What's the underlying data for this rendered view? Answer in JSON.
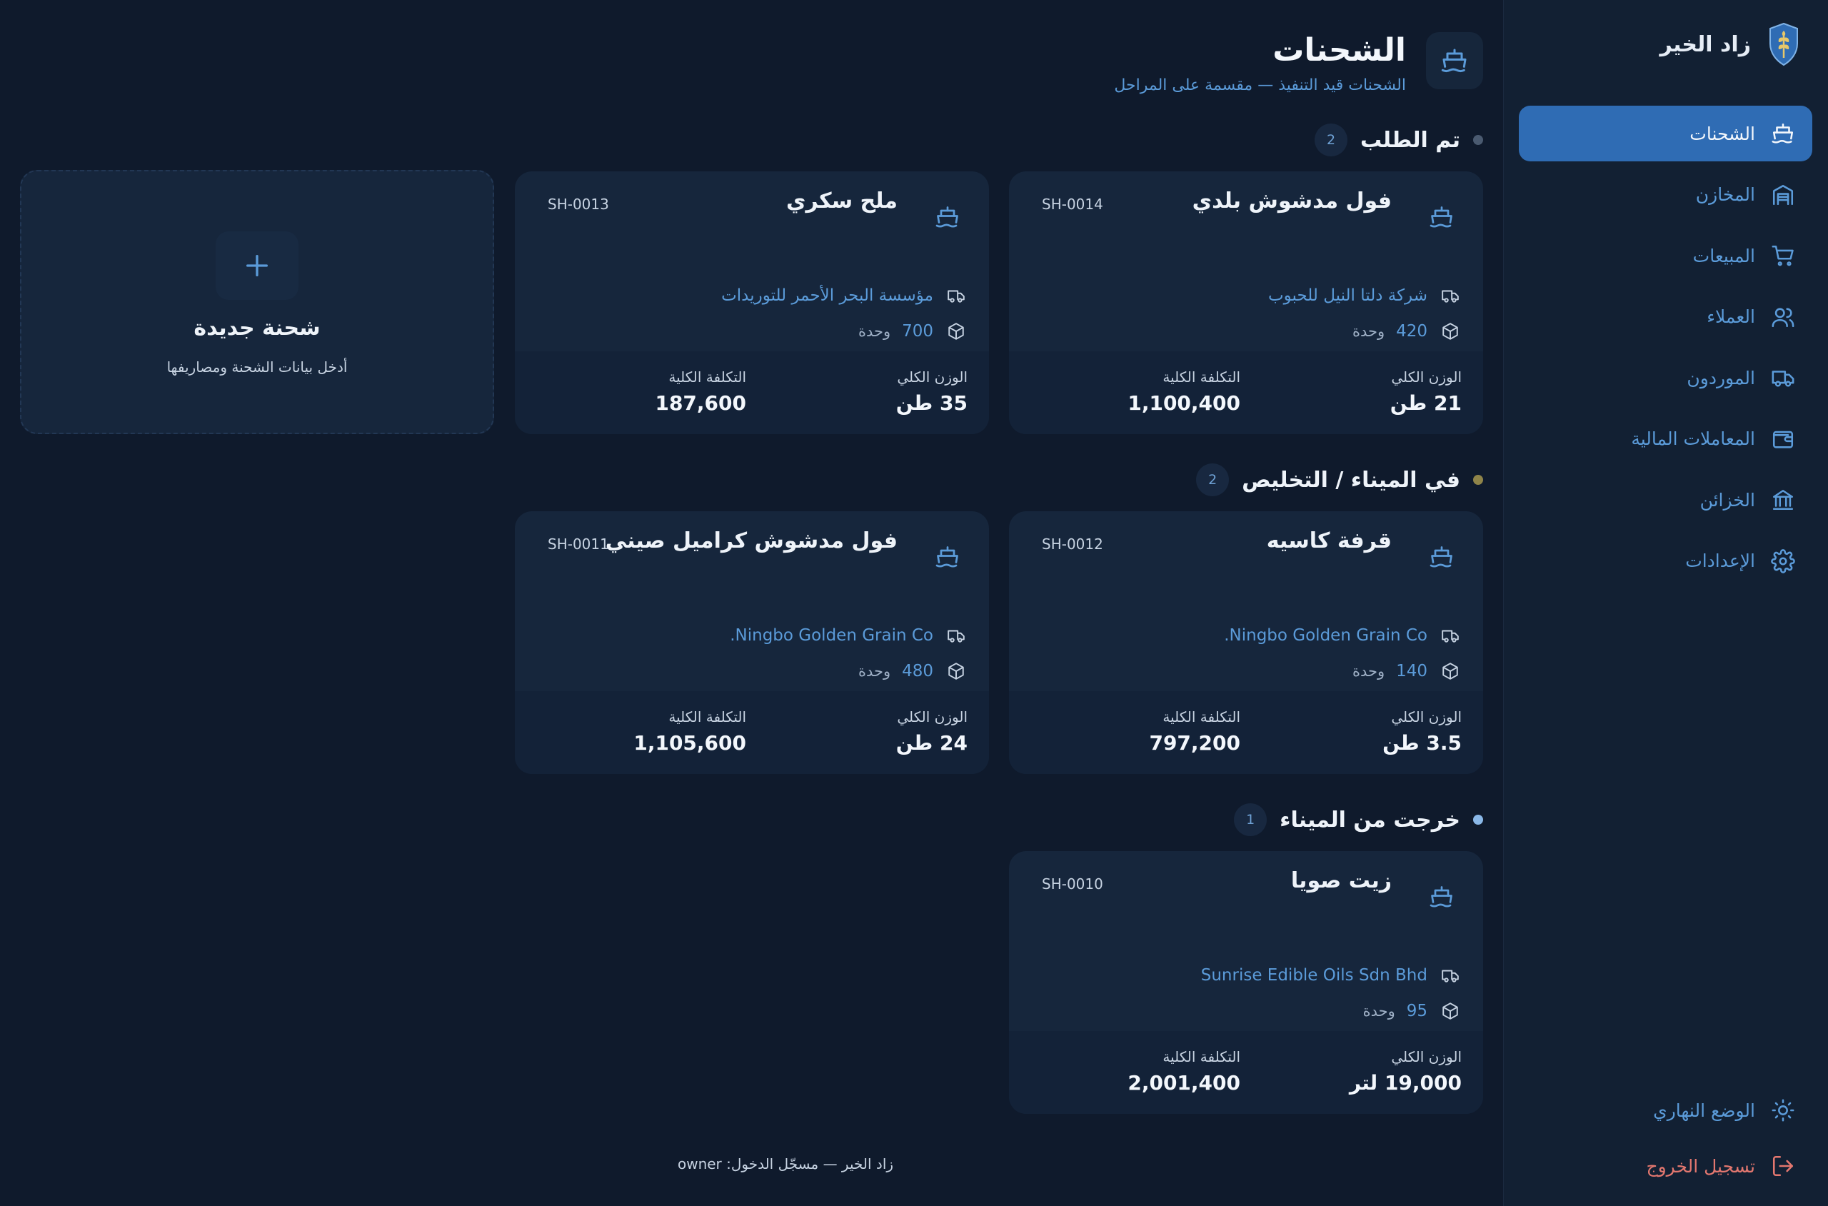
{
  "brand": {
    "name": "زاد الخير",
    "logo_icon": "wheat-shield-icon"
  },
  "sidebar": {
    "items": [
      {
        "label": "الشحنات",
        "icon": "ship-icon",
        "active": true
      },
      {
        "label": "المخازن",
        "icon": "warehouse-icon",
        "active": false
      },
      {
        "label": "المبيعات",
        "icon": "cart-icon",
        "active": false
      },
      {
        "label": "العملاء",
        "icon": "users-icon",
        "active": false
      },
      {
        "label": "الموردون",
        "icon": "truck-icon",
        "active": false
      },
      {
        "label": "المعاملات المالية",
        "icon": "wallet-icon",
        "active": false
      },
      {
        "label": "الخزائن",
        "icon": "bank-icon",
        "active": false
      },
      {
        "label": "الإعدادات",
        "icon": "gear-icon",
        "active": false
      }
    ],
    "theme_label": "الوضع النهاري",
    "logout_label": "تسجيل الخروج"
  },
  "page": {
    "title": "الشحنات",
    "subtitle": "الشحنات قيد التنفيذ — مقسمة على المراحل"
  },
  "stages": [
    {
      "title": "تم الطلب",
      "count": "2",
      "dot_color": "#4a5a70",
      "cards": [
        {
          "name": "فول مدشوش بلدي",
          "code": "SH-0014",
          "supplier": "شركة دلتا النيل للحبوب",
          "qty": "420",
          "unit": "وحدة",
          "weight_label": "الوزن الكلي",
          "weight": "21 طن",
          "cost_label": "التكلفة الكلية",
          "cost": "1,100,400"
        },
        {
          "name": "ملح سكري",
          "code": "SH-0013",
          "supplier": "مؤسسة البحر الأحمر للتوريدات",
          "qty": "700",
          "unit": "وحدة",
          "weight_label": "الوزن الكلي",
          "weight": "35 طن",
          "cost_label": "التكلفة الكلية",
          "cost": "187,600"
        }
      ]
    },
    {
      "title": "في الميناء / التخليص",
      "count": "2",
      "dot_color": "#8f8449",
      "cards": [
        {
          "name": "قرفة كاسيه",
          "code": "SH-0012",
          "supplier": "Ningbo Golden Grain Co.",
          "qty": "140",
          "unit": "وحدة",
          "weight_label": "الوزن الكلي",
          "weight": "3.5 طن",
          "cost_label": "التكلفة الكلية",
          "cost": "797,200"
        },
        {
          "name": "فول مدشوش كراميل صيني",
          "code": "SH-0011",
          "supplier": "Ningbo Golden Grain Co.",
          "qty": "480",
          "unit": "وحدة",
          "weight_label": "الوزن الكلي",
          "weight": "24 طن",
          "cost_label": "التكلفة الكلية",
          "cost": "1,105,600"
        }
      ]
    },
    {
      "title": "خرجت من الميناء",
      "count": "1",
      "dot_color": "#8ab8e8",
      "cards": [
        {
          "name": "زيت صويا",
          "code": "SH-0010",
          "supplier": "Sunrise Edible Oils Sdn Bhd",
          "qty": "95",
          "unit": "وحدة",
          "weight_label": "الوزن الكلي",
          "weight": "19,000 لتر",
          "cost_label": "التكلفة الكلية",
          "cost": "2,001,400"
        }
      ]
    }
  ],
  "new_shipment": {
    "title": "شحنة جديدة",
    "subtitle": "أدخل بيانات الشحنة ومصاريفها"
  },
  "footer": "زاد الخير — مسجّل الدخول: owner"
}
